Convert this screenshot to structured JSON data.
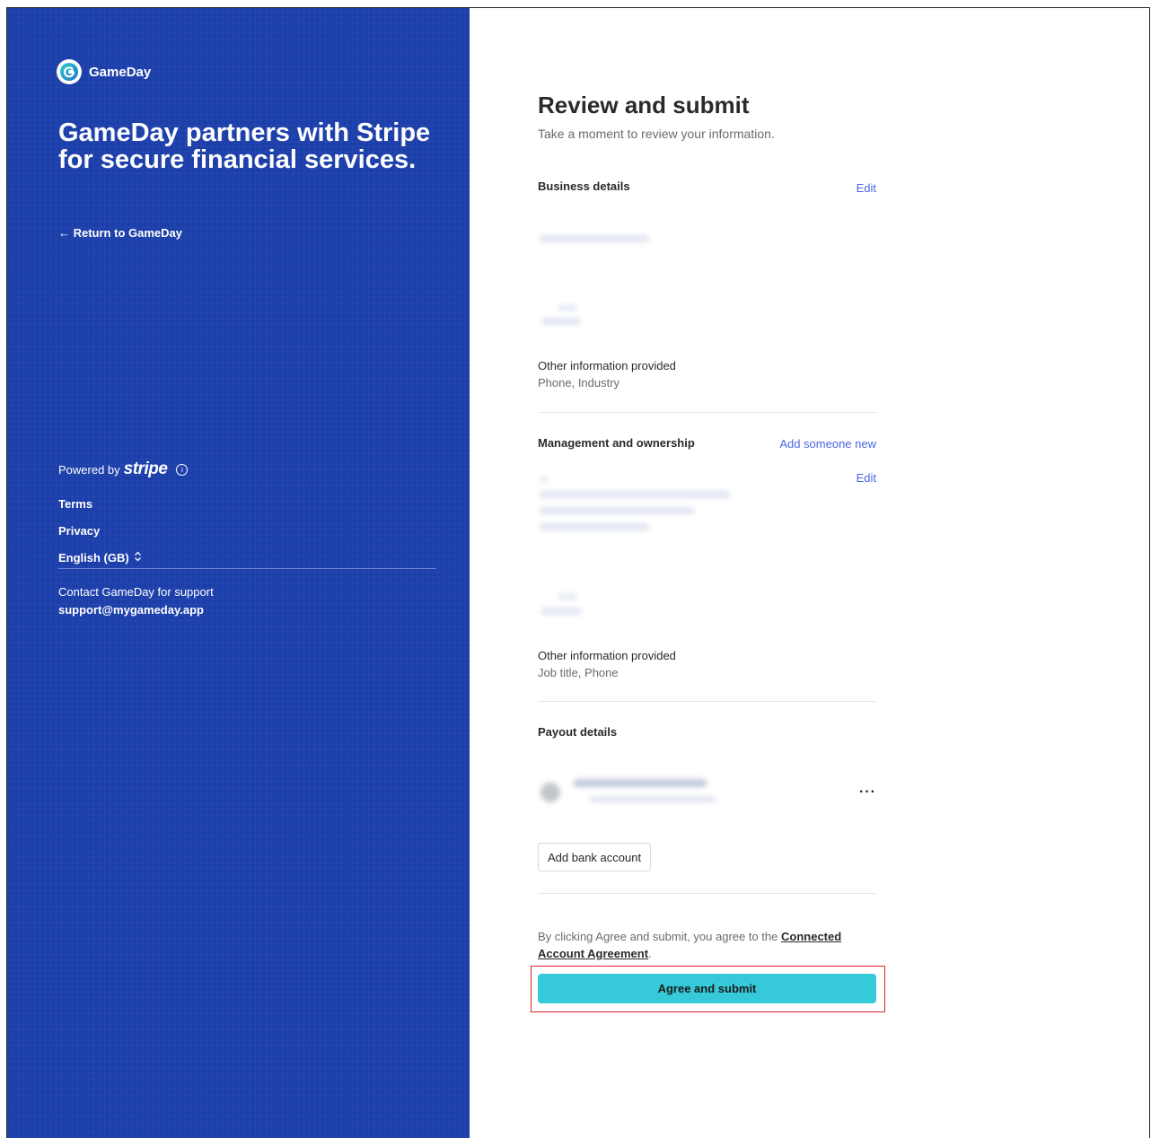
{
  "brand": {
    "name": "GameDay"
  },
  "left": {
    "headline": "GameDay partners with Stripe for secure financial services.",
    "return_link": "← Return to GameDay",
    "powered_by": "Powered by",
    "stripe_word": "stripe",
    "terms": "Terms",
    "privacy": "Privacy",
    "language": "English (GB)",
    "support_text": "Contact GameDay for support",
    "support_email": "support@mygameday.app"
  },
  "main": {
    "title": "Review and submit",
    "subtitle": "Take a moment to review your information.",
    "business": {
      "label": "Business details",
      "edit": "Edit",
      "other_label": "Other information provided",
      "other_value": "Phone, Industry"
    },
    "management": {
      "label": "Management and ownership",
      "add_new": "Add someone new",
      "edit": "Edit",
      "other_label": "Other information provided",
      "other_value": "Job title, Phone"
    },
    "payout": {
      "label": "Payout details",
      "more": "···",
      "add_bank": "Add bank account"
    },
    "agreement": {
      "prefix": "By clicking Agree and submit, you agree to the ",
      "link": "Connected Account Agreement",
      "suffix": "."
    },
    "submit_label": "Agree and submit"
  },
  "colors": {
    "left_panel": "#1c3faa",
    "link": "#4a66e0",
    "submit_button": "#36c9d9",
    "highlight": "#e0242a"
  }
}
